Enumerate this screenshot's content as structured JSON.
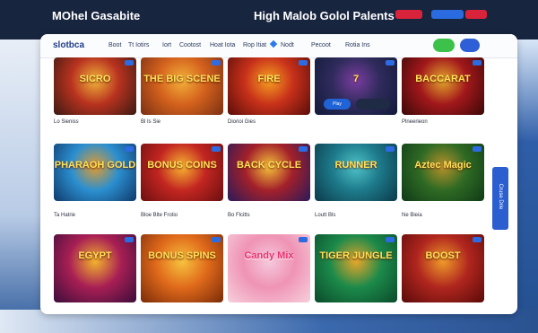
{
  "topbar": {
    "left_title": "MOhel Gasabite",
    "right_title": "High Malob Golol Palents",
    "pill_1": "",
    "pill_2": "",
    "pill_3": ""
  },
  "nav": {
    "logo": "slotbca",
    "items": [
      "Boot",
      "Tt Iotirs",
      "Iort",
      "Cootost",
      "Hoat Iota",
      "Rop Itiat",
      "Nodt",
      "Pecoot",
      "Rotia Ins"
    ],
    "btn_green": "",
    "btn_blue": ""
  },
  "side_tab": "Cruse Drie",
  "games": [
    {
      "title": "SICRO",
      "label": "Lo Sieniss",
      "colors": [
        "#3a1a12",
        "#b8321f",
        "#f0b23a"
      ]
    },
    {
      "title": "THE BIG SCENE",
      "label": "Bl Is Sie",
      "colors": [
        "#7a2f12",
        "#d4621d",
        "#f3b13a"
      ]
    },
    {
      "title": "FIRE",
      "label": "Diorioi Gies",
      "colors": [
        "#5a0d0a",
        "#c8311a",
        "#f6a021"
      ]
    },
    {
      "title": "7",
      "label": "",
      "colors": [
        "#121a3a",
        "#2f2b5c",
        "#7a3da0"
      ],
      "play": "Play"
    },
    {
      "title": "BACCARAT",
      "label": "Plneerieon",
      "colors": [
        "#3b0808",
        "#a2181b",
        "#e3a72c"
      ]
    },
    {
      "title": "PHARAOH GOLD",
      "label": "Ta Hatrie",
      "colors": [
        "#0f3a6a",
        "#2b8fd0",
        "#e39b2d"
      ]
    },
    {
      "title": "BONUS COINS",
      "label": "Bloe Blte Frotio",
      "colors": [
        "#6a0f10",
        "#c32621",
        "#f7b531"
      ]
    },
    {
      "title": "BACK CYCLE",
      "label": "Bo Flcitts",
      "colors": [
        "#2a1a5a",
        "#a3202a",
        "#f5c23a"
      ]
    },
    {
      "title": "RUNNER",
      "label": "Loutt Bls",
      "colors": [
        "#0b3a4a",
        "#1d7a8a",
        "#4fc3c9"
      ]
    },
    {
      "title": "Aztec Magic",
      "label": "Ne Bieia",
      "colors": [
        "#0f3a16",
        "#2f6a24",
        "#b8912a"
      ]
    },
    {
      "title": "EGYPT",
      "label": "",
      "colors": [
        "#3a0d3a",
        "#a81f54",
        "#f2b32d"
      ]
    },
    {
      "title": "BONUS SPINS",
      "label": "",
      "colors": [
        "#7a2a08",
        "#e06a1b",
        "#f7c33e"
      ]
    },
    {
      "title": "Candy Mix",
      "label": "",
      "colors": [
        "#f7d0dc",
        "#ef93b4",
        "#f5c9dc"
      ]
    },
    {
      "title": "TIGER JUNGLE",
      "label": "",
      "colors": [
        "#0a4a2a",
        "#1c8a4a",
        "#e8a52a"
      ]
    },
    {
      "title": "BOOST",
      "label": "",
      "colors": [
        "#5a0a0a",
        "#b0261e",
        "#ee9a2a"
      ]
    }
  ]
}
